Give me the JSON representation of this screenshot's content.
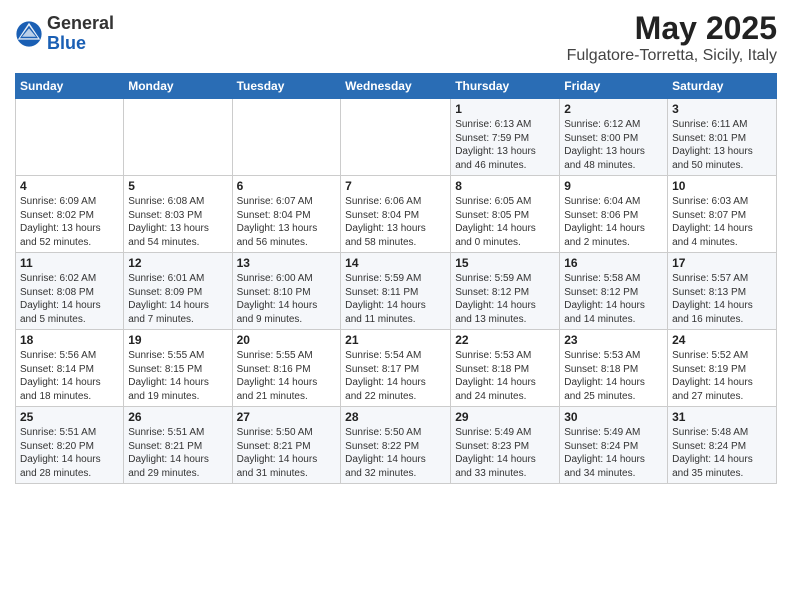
{
  "logo": {
    "general": "General",
    "blue": "Blue"
  },
  "title": "May 2025",
  "subtitle": "Fulgatore-Torretta, Sicily, Italy",
  "days_header": [
    "Sunday",
    "Monday",
    "Tuesday",
    "Wednesday",
    "Thursday",
    "Friday",
    "Saturday"
  ],
  "weeks": [
    [
      {
        "day": "",
        "info": ""
      },
      {
        "day": "",
        "info": ""
      },
      {
        "day": "",
        "info": ""
      },
      {
        "day": "",
        "info": ""
      },
      {
        "day": "1",
        "info": "Sunrise: 6:13 AM\nSunset: 7:59 PM\nDaylight: 13 hours\nand 46 minutes."
      },
      {
        "day": "2",
        "info": "Sunrise: 6:12 AM\nSunset: 8:00 PM\nDaylight: 13 hours\nand 48 minutes."
      },
      {
        "day": "3",
        "info": "Sunrise: 6:11 AM\nSunset: 8:01 PM\nDaylight: 13 hours\nand 50 minutes."
      }
    ],
    [
      {
        "day": "4",
        "info": "Sunrise: 6:09 AM\nSunset: 8:02 PM\nDaylight: 13 hours\nand 52 minutes."
      },
      {
        "day": "5",
        "info": "Sunrise: 6:08 AM\nSunset: 8:03 PM\nDaylight: 13 hours\nand 54 minutes."
      },
      {
        "day": "6",
        "info": "Sunrise: 6:07 AM\nSunset: 8:04 PM\nDaylight: 13 hours\nand 56 minutes."
      },
      {
        "day": "7",
        "info": "Sunrise: 6:06 AM\nSunset: 8:04 PM\nDaylight: 13 hours\nand 58 minutes."
      },
      {
        "day": "8",
        "info": "Sunrise: 6:05 AM\nSunset: 8:05 PM\nDaylight: 14 hours\nand 0 minutes."
      },
      {
        "day": "9",
        "info": "Sunrise: 6:04 AM\nSunset: 8:06 PM\nDaylight: 14 hours\nand 2 minutes."
      },
      {
        "day": "10",
        "info": "Sunrise: 6:03 AM\nSunset: 8:07 PM\nDaylight: 14 hours\nand 4 minutes."
      }
    ],
    [
      {
        "day": "11",
        "info": "Sunrise: 6:02 AM\nSunset: 8:08 PM\nDaylight: 14 hours\nand 5 minutes."
      },
      {
        "day": "12",
        "info": "Sunrise: 6:01 AM\nSunset: 8:09 PM\nDaylight: 14 hours\nand 7 minutes."
      },
      {
        "day": "13",
        "info": "Sunrise: 6:00 AM\nSunset: 8:10 PM\nDaylight: 14 hours\nand 9 minutes."
      },
      {
        "day": "14",
        "info": "Sunrise: 5:59 AM\nSunset: 8:11 PM\nDaylight: 14 hours\nand 11 minutes."
      },
      {
        "day": "15",
        "info": "Sunrise: 5:59 AM\nSunset: 8:12 PM\nDaylight: 14 hours\nand 13 minutes."
      },
      {
        "day": "16",
        "info": "Sunrise: 5:58 AM\nSunset: 8:12 PM\nDaylight: 14 hours\nand 14 minutes."
      },
      {
        "day": "17",
        "info": "Sunrise: 5:57 AM\nSunset: 8:13 PM\nDaylight: 14 hours\nand 16 minutes."
      }
    ],
    [
      {
        "day": "18",
        "info": "Sunrise: 5:56 AM\nSunset: 8:14 PM\nDaylight: 14 hours\nand 18 minutes."
      },
      {
        "day": "19",
        "info": "Sunrise: 5:55 AM\nSunset: 8:15 PM\nDaylight: 14 hours\nand 19 minutes."
      },
      {
        "day": "20",
        "info": "Sunrise: 5:55 AM\nSunset: 8:16 PM\nDaylight: 14 hours\nand 21 minutes."
      },
      {
        "day": "21",
        "info": "Sunrise: 5:54 AM\nSunset: 8:17 PM\nDaylight: 14 hours\nand 22 minutes."
      },
      {
        "day": "22",
        "info": "Sunrise: 5:53 AM\nSunset: 8:18 PM\nDaylight: 14 hours\nand 24 minutes."
      },
      {
        "day": "23",
        "info": "Sunrise: 5:53 AM\nSunset: 8:18 PM\nDaylight: 14 hours\nand 25 minutes."
      },
      {
        "day": "24",
        "info": "Sunrise: 5:52 AM\nSunset: 8:19 PM\nDaylight: 14 hours\nand 27 minutes."
      }
    ],
    [
      {
        "day": "25",
        "info": "Sunrise: 5:51 AM\nSunset: 8:20 PM\nDaylight: 14 hours\nand 28 minutes."
      },
      {
        "day": "26",
        "info": "Sunrise: 5:51 AM\nSunset: 8:21 PM\nDaylight: 14 hours\nand 29 minutes."
      },
      {
        "day": "27",
        "info": "Sunrise: 5:50 AM\nSunset: 8:21 PM\nDaylight: 14 hours\nand 31 minutes."
      },
      {
        "day": "28",
        "info": "Sunrise: 5:50 AM\nSunset: 8:22 PM\nDaylight: 14 hours\nand 32 minutes."
      },
      {
        "day": "29",
        "info": "Sunrise: 5:49 AM\nSunset: 8:23 PM\nDaylight: 14 hours\nand 33 minutes."
      },
      {
        "day": "30",
        "info": "Sunrise: 5:49 AM\nSunset: 8:24 PM\nDaylight: 14 hours\nand 34 minutes."
      },
      {
        "day": "31",
        "info": "Sunrise: 5:48 AM\nSunset: 8:24 PM\nDaylight: 14 hours\nand 35 minutes."
      }
    ]
  ]
}
